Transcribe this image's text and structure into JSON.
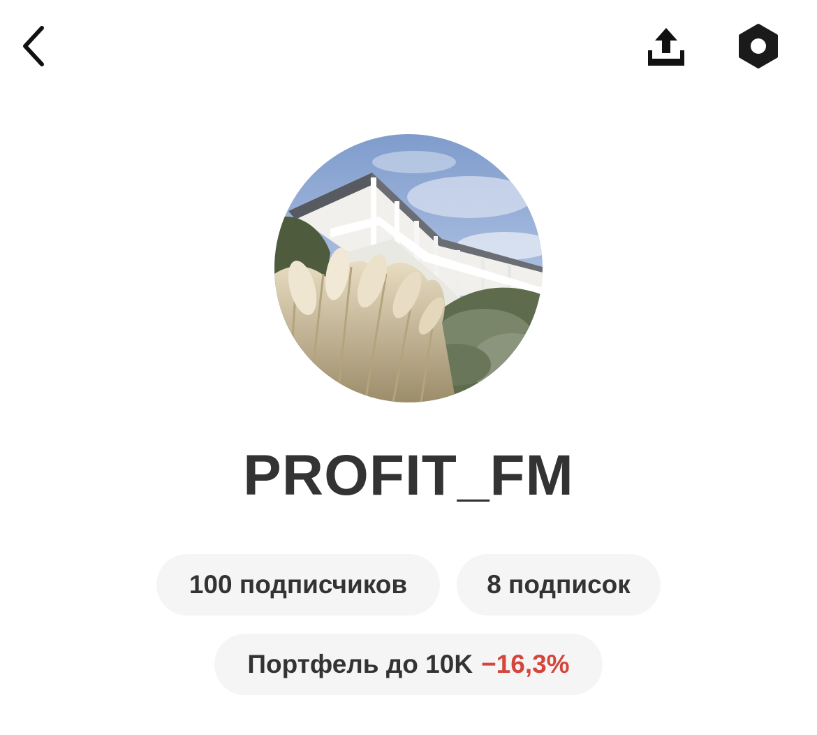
{
  "header": {
    "back_icon": "chevron-left-icon",
    "share_icon": "share-upload-icon",
    "settings_icon": "hexagon-nut-settings-icon"
  },
  "profile": {
    "avatar": "avatar-photo-terrace-pampas-grass",
    "username": "PROFIT_FM"
  },
  "stats": {
    "followers_label": "100 подписчиков",
    "following_label": "8 подписок"
  },
  "portfolio": {
    "name": "Портфель до 10K",
    "change": "−16,3%",
    "change_color": "#d4453c"
  }
}
